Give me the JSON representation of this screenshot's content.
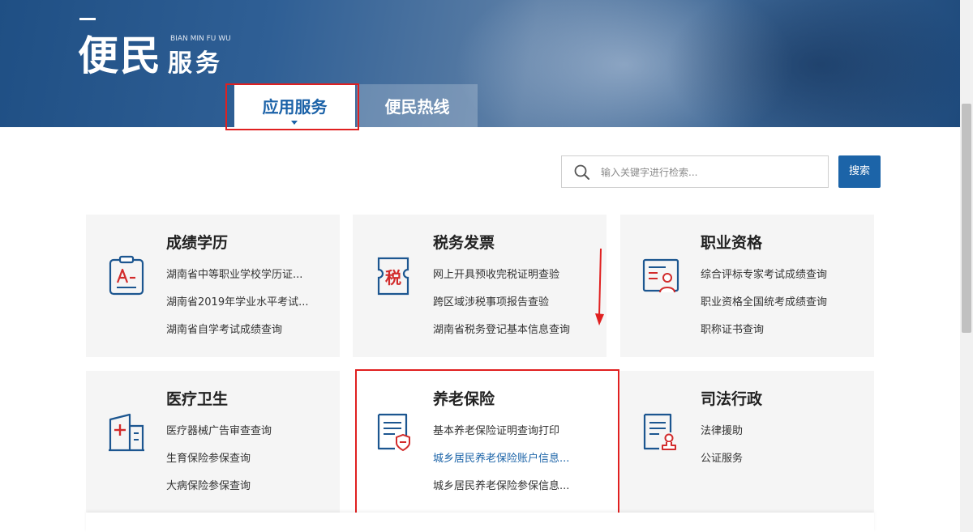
{
  "banner": {
    "title_big": "便民",
    "title_small": "服务",
    "title_pinyin": "BIAN MIN FU WU"
  },
  "tabs": [
    {
      "label": "应用服务",
      "active": true
    },
    {
      "label": "便民热线",
      "active": false
    }
  ],
  "search": {
    "placeholder": "输入关键字进行检索...",
    "button_label": "搜索"
  },
  "cards": [
    {
      "title": "成绩学历",
      "icon": "grade-report-icon",
      "links": [
        "湖南省中等职业学校学历证...",
        "湖南省2019年学业水平考试...",
        "湖南省自学考试成绩查询"
      ]
    },
    {
      "title": "税务发票",
      "icon": "tax-ticket-icon",
      "links": [
        "网上开具预收完税证明查验",
        "跨区域涉税事项报告查验",
        "湖南省税务登记基本信息查询"
      ]
    },
    {
      "title": "职业资格",
      "icon": "professional-certificate-icon",
      "links": [
        "综合评标专家考试成绩查询",
        "职业资格全国统考成绩查询",
        "职称证书查询"
      ]
    },
    {
      "title": "医疗卫生",
      "icon": "hospital-icon",
      "links": [
        "医疗器械广告审查查询",
        "生育保险参保查询",
        "大病保险参保查询"
      ]
    },
    {
      "title": "养老保险",
      "icon": "pension-insurance-icon",
      "links": [
        "基本养老保险证明查询打印",
        "城乡居民养老保险账户信息...",
        "城乡居民养老保险参保信息..."
      ]
    },
    {
      "title": "司法行政",
      "icon": "judicial-document-icon",
      "links": [
        "法律援助",
        "公证服务"
      ]
    }
  ],
  "colors": {
    "accent": "#1c64a8",
    "highlight_box": "#e02020",
    "card_bg": "#f5f5f5"
  }
}
